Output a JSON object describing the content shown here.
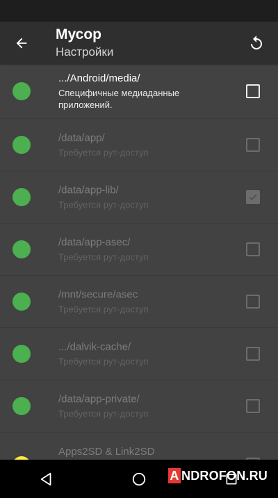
{
  "app_bar": {
    "title": "Мусор",
    "subtitle": "Настройки"
  },
  "icons": {
    "back": "arrow-left-icon",
    "refresh": "refresh-icon"
  },
  "colors": {
    "status_green": "#4caf50",
    "status_yellow": "#ffeb3b"
  },
  "items": [
    {
      "path": ".../Android/media/",
      "description": "Специфичные медиаданные приложений.",
      "checked": false,
      "enabled": true,
      "dot": "#4caf50"
    },
    {
      "path": "/data/app/",
      "description": "Требуется рут-доступ",
      "checked": false,
      "enabled": false,
      "dot": "#4caf50"
    },
    {
      "path": "/data/app-lib/",
      "description": "Требуется рут-доступ",
      "checked": true,
      "enabled": false,
      "dot": "#4caf50"
    },
    {
      "path": "/data/app-asec/",
      "description": "Требуется рут-доступ",
      "checked": false,
      "enabled": false,
      "dot": "#4caf50"
    },
    {
      "path": "/mnt/secure/asec",
      "description": "Требуется рут-доступ",
      "checked": false,
      "enabled": false,
      "dot": "#4caf50"
    },
    {
      "path": ".../dalvik-cache/",
      "description": "Требуется рут-доступ",
      "checked": false,
      "enabled": false,
      "dot": "#4caf50"
    },
    {
      "path": "/data/app-private/",
      "description": "Требуется рут-доступ",
      "checked": false,
      "enabled": false,
      "dot": "#4caf50"
    },
    {
      "path": "Apps2SD & Link2SD",
      "description": "",
      "checked": false,
      "enabled": false,
      "dot": "#ffeb3b"
    }
  ],
  "watermark": {
    "first_letter": "A",
    "rest": "NDROFON.RU"
  }
}
